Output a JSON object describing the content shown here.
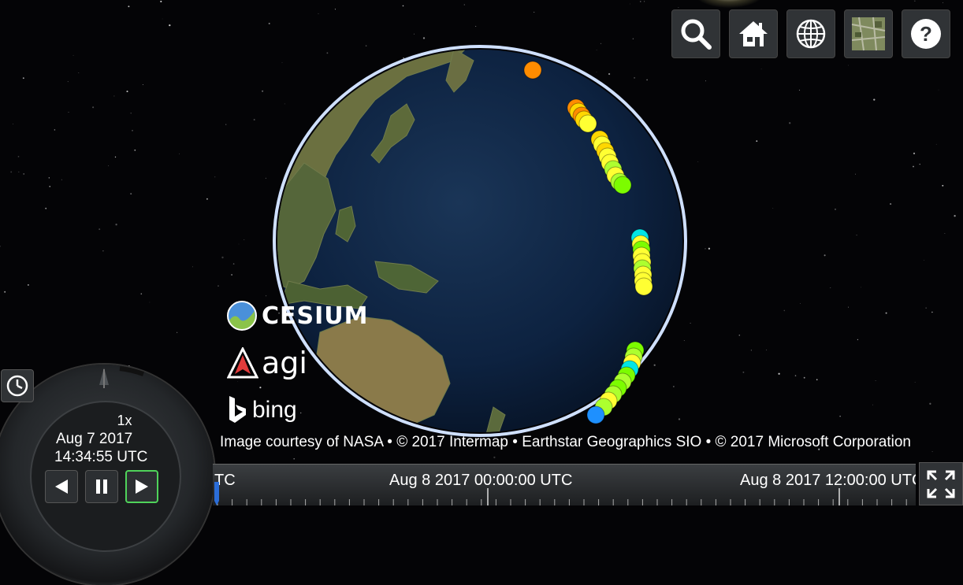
{
  "credits": {
    "cesium": "CESIUM",
    "agi": "agi",
    "bing": "bing",
    "attribution": "Image courtesy of NASA • © 2017 Intermap • Earthstar Geographics SIO • © 2017 Microsoft Corporation"
  },
  "animation": {
    "speed": "1x",
    "date": "Aug 7 2017",
    "time": "14:34:55 UTC"
  },
  "timeline": {
    "labels": [
      "TC",
      "Aug 8 2017 00:00:00 UTC",
      "Aug 8 2017 12:00:00 UTC"
    ]
  },
  "toolbar": {
    "buttons": [
      "search",
      "home",
      "globe (scene mode)",
      "imagery picker",
      "help"
    ]
  },
  "colors": {
    "background": "#040406",
    "globe_ocean": "#0d2240",
    "atmosphere": "#9fc4ff",
    "play_active": "#4fd35a",
    "point_scale": [
      "#ff8c00",
      "#ffd700",
      "#ffff33",
      "#adff2f",
      "#7cfc00",
      "#00e5e5",
      "#1e90ff"
    ]
  },
  "icons": {
    "search": "magnifier-icon",
    "home": "house-icon",
    "scene": "wireframe-globe-icon",
    "imagery": "satellite-thumbnail-icon",
    "help": "question-icon",
    "clock": "clock-icon",
    "fullscreen": "expand-arrows-icon"
  }
}
